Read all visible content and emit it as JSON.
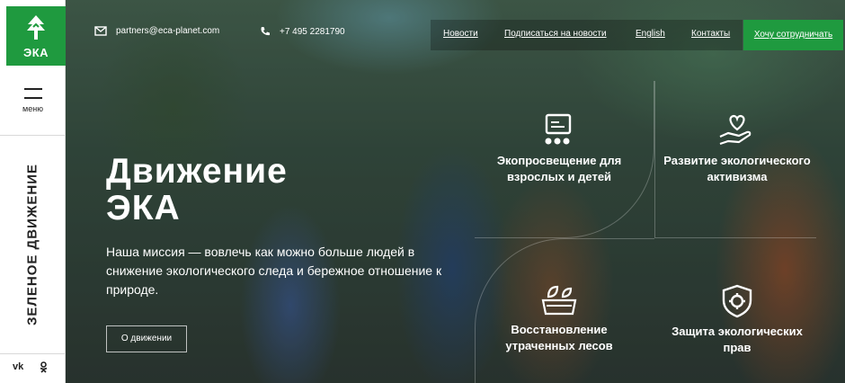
{
  "logo": {
    "text": "ЭКА"
  },
  "sidebar": {
    "menu_label": "меню",
    "vertical_text": "ЗЕЛЕНОЕ ДВИЖЕНИЕ",
    "social": [
      "vk",
      "ok"
    ]
  },
  "topbar": {
    "email": "partners@eca-planet.com",
    "phone": "+7 495 2281790",
    "nav": [
      "Новости",
      "Подписаться на новости",
      "English",
      "Контакты"
    ],
    "cta": "Хочу сотрудничать"
  },
  "hero": {
    "title_line1": "Движение",
    "title_line2": "ЭКА",
    "mission": "Наша миссия — вовлечь как можно больше людей в снижение экологического следа и бережное отношение к природе.",
    "about_button": "О движении"
  },
  "features": [
    {
      "label": "Экопросвещение для взрослых и детей",
      "icon": "presentation-icon"
    },
    {
      "label": "Развитие экологического активизма",
      "icon": "heart-hand-icon"
    },
    {
      "label": "Восстановление утраченных лесов",
      "icon": "seedling-box-icon"
    },
    {
      "label": "Защита экологических прав",
      "icon": "shield-gear-icon"
    }
  ],
  "colors": {
    "brand_green": "#1f9a3f"
  }
}
